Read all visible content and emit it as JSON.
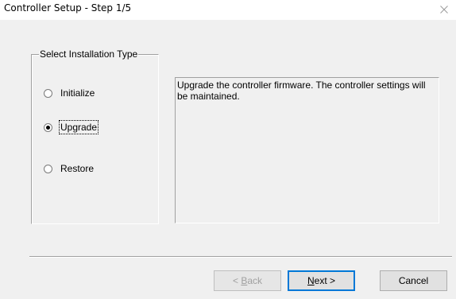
{
  "window": {
    "title": "Controller Setup - Step 1/5"
  },
  "group": {
    "legend": "Select Installation Type",
    "options": [
      {
        "label": "Initialize",
        "selected": false
      },
      {
        "label": "Upgrade",
        "selected": true
      },
      {
        "label": "Restore",
        "selected": false
      }
    ]
  },
  "description": {
    "text": "Upgrade the controller firmware. The controller settings will be maintained."
  },
  "buttons": {
    "back": {
      "prefix": "< ",
      "accel": "B",
      "rest": "ack",
      "enabled": false
    },
    "next": {
      "accel": "N",
      "rest": "ext >",
      "enabled": true
    },
    "cancel": {
      "label": "Cancel",
      "enabled": true
    }
  },
  "icons": {
    "close": "close-icon"
  },
  "colors": {
    "background": "#f0f0f0",
    "default_button_border": "#0078d7",
    "disabled_text": "#a0a0a0"
  }
}
